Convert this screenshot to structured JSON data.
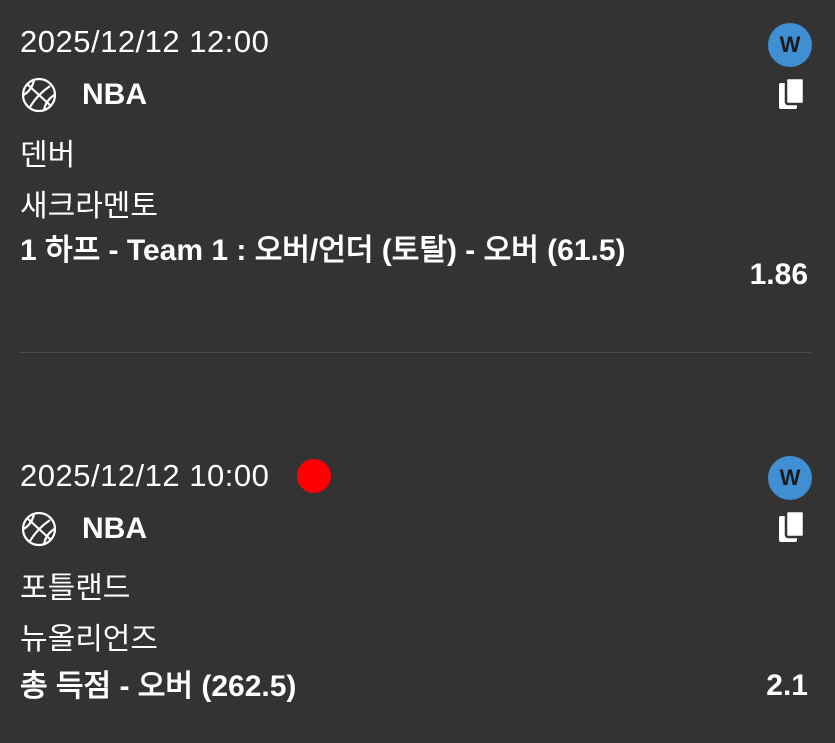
{
  "colors": {
    "background": "#333333",
    "text": "#ffffff",
    "badge": "#3f8fd2",
    "live_dot": "#ff0000",
    "divider": "#4d4d4d"
  },
  "bets": [
    {
      "datetime": "2025/12/12 12:00",
      "live_indicator": false,
      "league_icon": "basketball-icon",
      "league": "NBA",
      "home_team": "덴버",
      "away_team": "새크라멘토",
      "market": "1 하프 - Team 1 : 오버/언더 (토탈) - 오버 (61.5)",
      "odds": "1.86",
      "badge": "W",
      "action_icon": "copy-icon"
    },
    {
      "datetime": "2025/12/12 10:00",
      "live_indicator": true,
      "league_icon": "basketball-icon",
      "league": "NBA",
      "home_team": "포틀랜드",
      "away_team": "뉴올리언즈",
      "market": "총 득점 - 오버 (262.5)",
      "odds": "2.1",
      "badge": "W",
      "action_icon": "copy-icon"
    }
  ]
}
